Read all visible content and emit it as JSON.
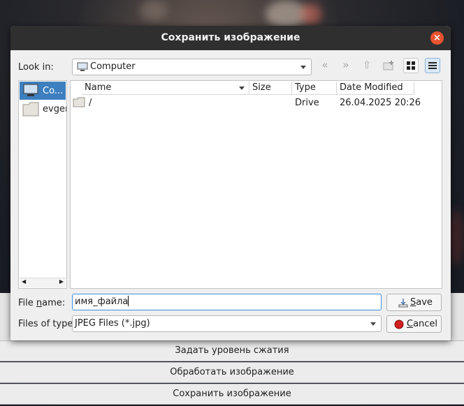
{
  "dialog": {
    "title": "Сохранить изображение",
    "look_in_label": "Look in:",
    "look_in_value": "Computer",
    "sidebar": [
      {
        "label": "Co...",
        "icon": "computer-icon",
        "selected": true
      },
      {
        "label": "evgen",
        "icon": "folder-icon",
        "selected": false
      }
    ],
    "columns": [
      "Name",
      "Size",
      "Type",
      "Date Modified"
    ],
    "rows": [
      {
        "name": "/",
        "size": "",
        "type": "Drive",
        "date": "26.04.2025 20:26"
      }
    ],
    "file_name_label_pre": "File ",
    "file_name_label_mnemonic": "n",
    "file_name_label_post": "ame:",
    "file_name_value": "имя_файла",
    "files_of_type_label": "Files of type:",
    "files_of_type_value": "JPEG Files (*.jpg)",
    "save_button_mnemonic": "S",
    "save_button_rest": "ave",
    "cancel_button_mnemonic": "C",
    "cancel_button_rest": "ancel"
  },
  "app": {
    "buttons": [
      "Задать уровень сжатия",
      "Обработать изображение",
      "Сохранить изображение"
    ]
  },
  "colors": {
    "accent": "#3d7fbf",
    "close": "#e9532f",
    "titlebar": "#2f2f2f"
  }
}
